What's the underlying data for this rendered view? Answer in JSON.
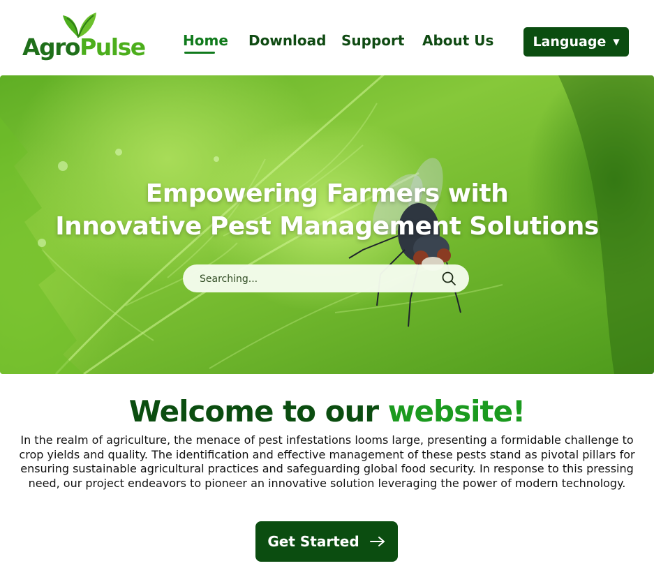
{
  "brand": {
    "part1": "Agro",
    "part2": "Pulse"
  },
  "nav": {
    "items": [
      {
        "label": "Home",
        "active": true
      },
      {
        "label": "Download"
      },
      {
        "label": "Support"
      },
      {
        "label": "About Us"
      }
    ],
    "language_label": "Language"
  },
  "hero": {
    "title_line1": "Empowering Farmers with",
    "title_line2": "Innovative Pest Management Solutions",
    "search_placeholder": "Searching..."
  },
  "welcome": {
    "title_part1": "Welcome to our",
    "title_part2": "website!",
    "body": "In the realm of agriculture, the menace of pest infestations looms large, presenting a formidable challenge to crop yields and quality. The identification and effective management of these pests stand as pivotal pillars for ensuring sustainable agricultural practices and safeguarding global food security. In response to this pressing need, our project endeavors to pioneer an innovative solution leveraging the power of modern technology.",
    "cta_label": "Get Started"
  },
  "colors": {
    "primary_dark": "#0b4d10",
    "accent_green": "#1b9a1f",
    "logo_dark": "#1f6f1a",
    "logo_light": "#4cae1c"
  },
  "icons": {
    "logo": "leaf-icon",
    "language": "caret-down-icon",
    "search": "search-icon",
    "cta": "arrow-right-icon"
  }
}
